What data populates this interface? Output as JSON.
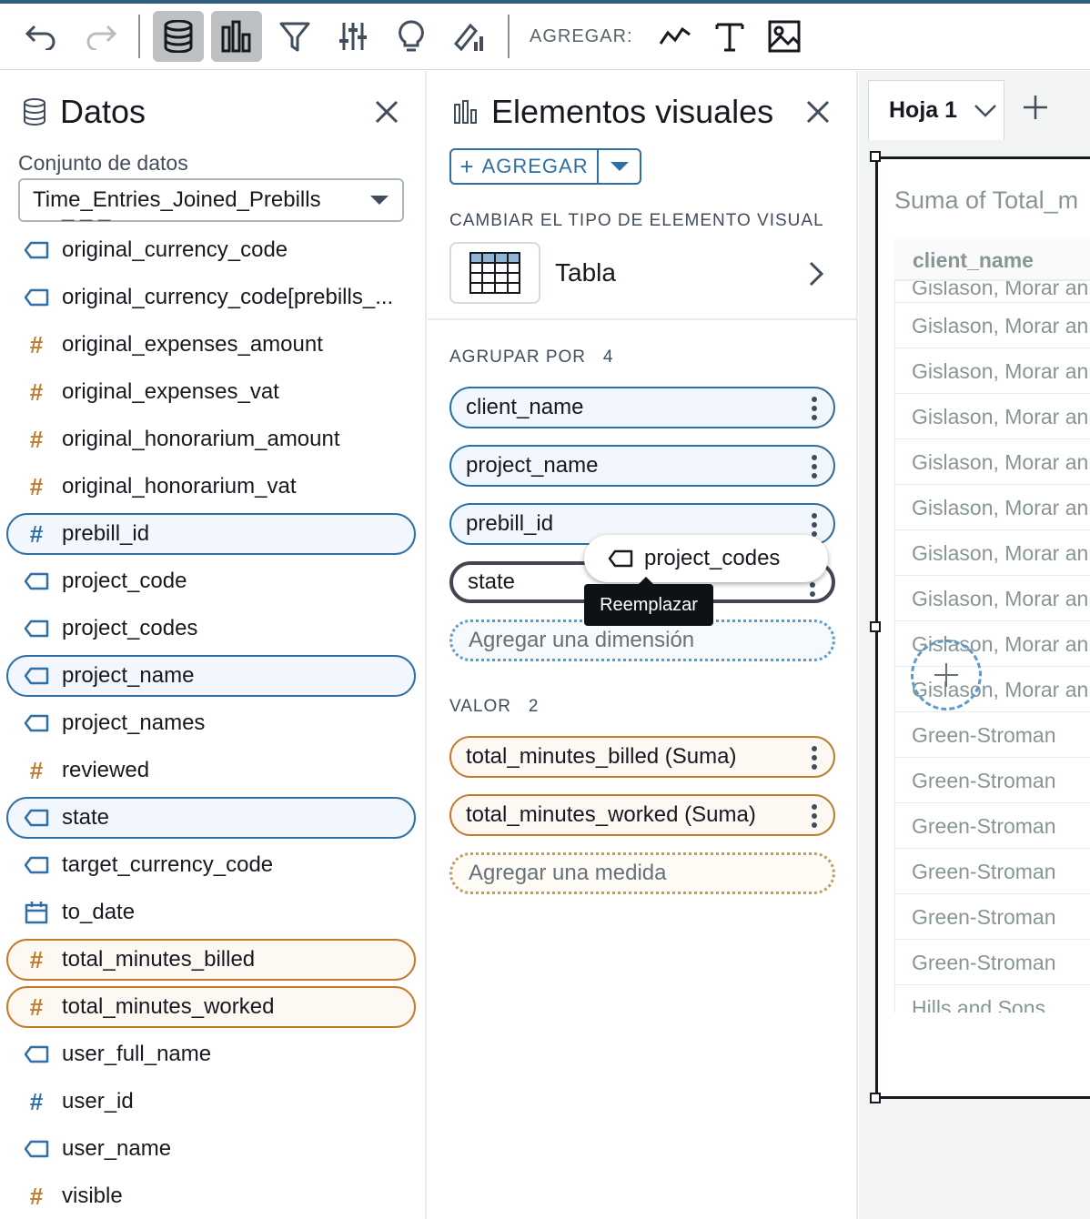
{
  "toolbar": {
    "add_label": "AGREGAR:"
  },
  "data_panel": {
    "title": "Datos",
    "dataset_label": "Conjunto de datos",
    "dataset_value": "Time_Entries_Joined_Prebills",
    "fields": [
      {
        "name": "original_currency_code",
        "type": "dim",
        "selected": false
      },
      {
        "name": "original_currency_code[prebills_...",
        "type": "dim",
        "selected": false
      },
      {
        "name": "original_expenses_amount",
        "type": "mea",
        "selected": false
      },
      {
        "name": "original_expenses_vat",
        "type": "mea",
        "selected": false
      },
      {
        "name": "original_honorarium_amount",
        "type": "mea",
        "selected": false
      },
      {
        "name": "original_honorarium_vat",
        "type": "mea",
        "selected": false
      },
      {
        "name": "prebill_id",
        "type": "dim-num",
        "selected": true
      },
      {
        "name": "project_code",
        "type": "dim",
        "selected": false
      },
      {
        "name": "project_codes",
        "type": "dim",
        "selected": false
      },
      {
        "name": "project_name",
        "type": "dim",
        "selected": true
      },
      {
        "name": "project_names",
        "type": "dim",
        "selected": false
      },
      {
        "name": "reviewed",
        "type": "mea",
        "selected": false
      },
      {
        "name": "state",
        "type": "dim",
        "selected": true
      },
      {
        "name": "target_currency_code",
        "type": "dim",
        "selected": false
      },
      {
        "name": "to_date",
        "type": "date",
        "selected": false
      },
      {
        "name": "total_minutes_billed",
        "type": "mea",
        "selected": true
      },
      {
        "name": "total_minutes_worked",
        "type": "mea",
        "selected": true
      },
      {
        "name": "user_full_name",
        "type": "dim",
        "selected": false
      },
      {
        "name": "user_id",
        "type": "dim-num",
        "selected": false
      },
      {
        "name": "user_name",
        "type": "dim",
        "selected": false
      },
      {
        "name": "visible",
        "type": "mea",
        "selected": false
      }
    ]
  },
  "visuals_panel": {
    "title": "Elementos visuales",
    "add_button": "AGREGAR",
    "change_type_label": "CAMBIAR EL TIPO DE ELEMENTO VISUAL",
    "visual_type": "Tabla",
    "group_by_label": "AGRUPAR POR",
    "group_by_count": "4",
    "group_by": [
      "client_name",
      "project_name",
      "prebill_id",
      "state"
    ],
    "add_dimension": "Agregar una dimensión",
    "value_label": "VALOR",
    "value_count": "2",
    "values": [
      "total_minutes_billed (Suma)",
      "total_minutes_worked (Suma)"
    ],
    "add_measure": "Agregar una medida",
    "drag_chip": "project_codes",
    "tooltip": "Reemplazar"
  },
  "sheet": {
    "tab_name": "Hoja 1",
    "visual_title": "Suma of Total_m",
    "column_header": "client_name",
    "rows": [
      "Gislason, Morar an",
      "Gislason, Morar an",
      "Gislason, Morar an",
      "Gislason, Morar an",
      "Gislason, Morar an",
      "Gislason, Morar an",
      "Gislason, Morar an",
      "Gislason, Morar an",
      "Gislason, Morar an",
      "Green-Stroman",
      "Green-Stroman",
      "Green-Stroman",
      "Green-Stroman",
      "Green-Stroman",
      "Green-Stroman",
      "Hills and Sons",
      "Hills and Sons"
    ]
  }
}
